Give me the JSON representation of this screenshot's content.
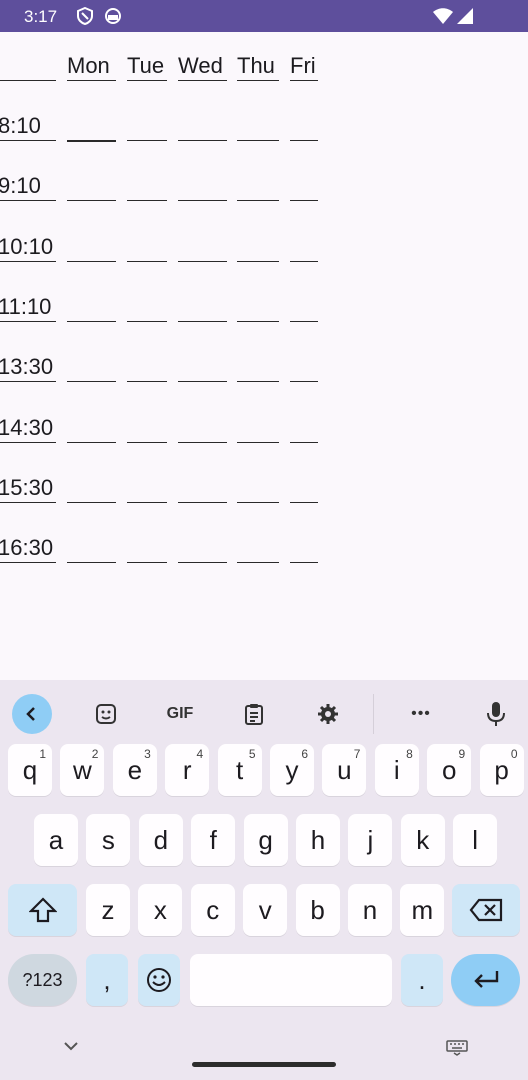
{
  "status_bar": {
    "time": "3:17",
    "icons": [
      "shield-icon",
      "circle-icon",
      "wifi-icon",
      "signal-icon"
    ]
  },
  "timetable": {
    "days": [
      "Mon",
      "Tue",
      "Wed",
      "Thu",
      "Fri"
    ],
    "times": [
      "8:10",
      "9:10",
      "10:10",
      "11:10",
      "13:30",
      "14:30",
      "15:30",
      "16:30"
    ]
  },
  "keyboard": {
    "toolbar": [
      "back-chevron-icon",
      "sticker-icon",
      "GIF",
      "clipboard-icon",
      "gear-icon",
      "more-icon",
      "mic-icon"
    ],
    "gif_label": "GIF",
    "more_label": "•••",
    "row1": [
      {
        "key": "q",
        "num": "1"
      },
      {
        "key": "w",
        "num": "2"
      },
      {
        "key": "e",
        "num": "3"
      },
      {
        "key": "r",
        "num": "4"
      },
      {
        "key": "t",
        "num": "5"
      },
      {
        "key": "y",
        "num": "6"
      },
      {
        "key": "u",
        "num": "7"
      },
      {
        "key": "i",
        "num": "8"
      },
      {
        "key": "o",
        "num": "9"
      },
      {
        "key": "p",
        "num": "0"
      }
    ],
    "row2": [
      "a",
      "s",
      "d",
      "f",
      "g",
      "h",
      "j",
      "k",
      "l"
    ],
    "row3": [
      "z",
      "x",
      "c",
      "v",
      "b",
      "n",
      "m"
    ],
    "symbols_label": "?123",
    "comma_label": ",",
    "period_label": ".",
    "accent_color": "#8fcdf5"
  }
}
